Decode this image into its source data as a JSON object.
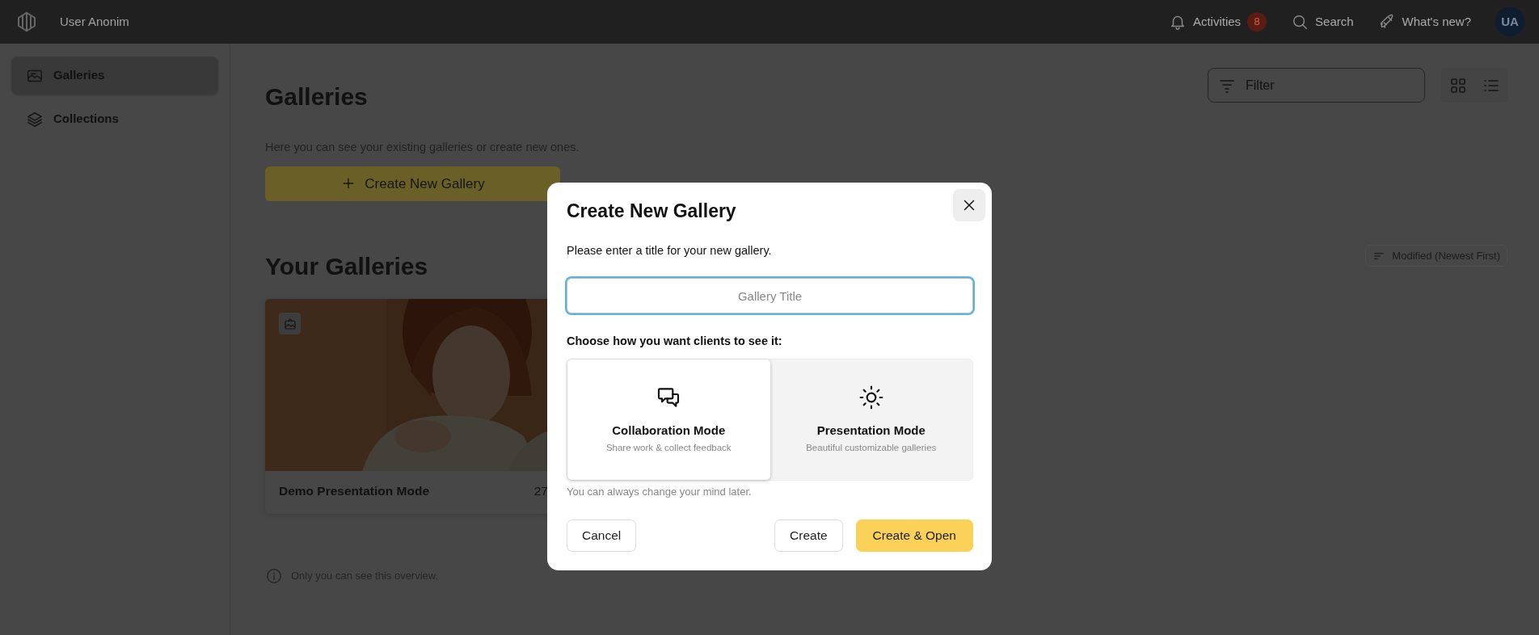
{
  "top_bar": {
    "user_name": "User Anonim",
    "activities": {
      "label": "Activities",
      "badge": "8"
    },
    "search": "Search",
    "whats_new": "What's new?",
    "avatar": "UA"
  },
  "sidebar": {
    "items": [
      {
        "label": "Galleries",
        "kind": "gallery",
        "selected": true
      },
      {
        "label": "Collections",
        "kind": "layers",
        "selected": false
      }
    ]
  },
  "page": {
    "title": "Galleries",
    "subtitle": "Here you can see your existing galleries or create new ones.",
    "create_button": "Create New Gallery",
    "filter": {
      "placeholder": "Filter"
    },
    "view_toggle": [
      {
        "kind": "grid"
      },
      {
        "kind": "list"
      }
    ],
    "section_title": "Your Galleries",
    "sort": "Modified (Newest First)",
    "galleries": [
      {
        "title": "Demo Presentation Mode",
        "date": "27",
        "kind": "picture"
      }
    ],
    "note": "Only you can see this overview."
  },
  "dialog": {
    "title": "Create New Gallery",
    "prompt": "Please enter a title for your new gallery.",
    "title_field": {
      "placeholder": "Gallery Title",
      "focused": true
    },
    "modes_label": "Choose how you want clients to see it:",
    "modes": [
      {
        "kind": "collaboration",
        "title": "Collaboration Mode",
        "subtitle": "Share work & collect feedback",
        "selected": true
      },
      {
        "kind": "presentation",
        "title": "Presentation Mode",
        "subtitle": "Beautiful customizable galleries",
        "selected": false
      }
    ],
    "hint": "You can always change your mind later.",
    "buttons": [
      {
        "kind": "cancel",
        "label": "Cancel"
      },
      {
        "kind": "secondary",
        "label": "Create"
      },
      {
        "kind": "primary",
        "label": "Create & Open"
      }
    ]
  }
}
